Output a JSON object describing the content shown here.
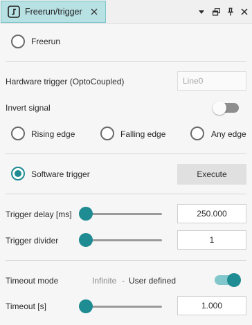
{
  "tab": {
    "title": "Freerun/trigger",
    "icon": "trigger-mode-icon"
  },
  "window_controls": [
    "dropdown-arrow-icon",
    "restore-window-icon",
    "pin-icon",
    "close-icon"
  ],
  "freerun": {
    "label": "Freerun",
    "selected": false
  },
  "hardware_trigger": {
    "label": "Hardware trigger (OptoCoupled)",
    "line_value": "Line0"
  },
  "invert_signal": {
    "label": "Invert signal",
    "on": false
  },
  "edges": [
    {
      "label": "Rising edge",
      "selected": false
    },
    {
      "label": "Falling edge",
      "selected": false
    },
    {
      "label": "Any edge",
      "selected": false
    }
  ],
  "software_trigger": {
    "label": "Software trigger",
    "selected": true,
    "execute_label": "Execute"
  },
  "trigger_delay": {
    "label": "Trigger delay [ms]",
    "value": "250.000",
    "slider_fraction": 0.0
  },
  "trigger_divider": {
    "label": "Trigger divider",
    "value": "1",
    "slider_fraction": 0.0
  },
  "timeout_mode": {
    "label": "Timeout mode",
    "option_infinite": "Infinite",
    "separator": "-",
    "option_user": "User defined",
    "selected": "User defined",
    "on": true
  },
  "timeout": {
    "label": "Timeout [s]",
    "value": "1.000",
    "slider_fraction": 0.0
  },
  "colors": {
    "accent": "#1f8b93",
    "tab_background": "#b8e1e4",
    "toggle_track_on": "#82c7cc",
    "muted_text": "#8a8a8a"
  }
}
